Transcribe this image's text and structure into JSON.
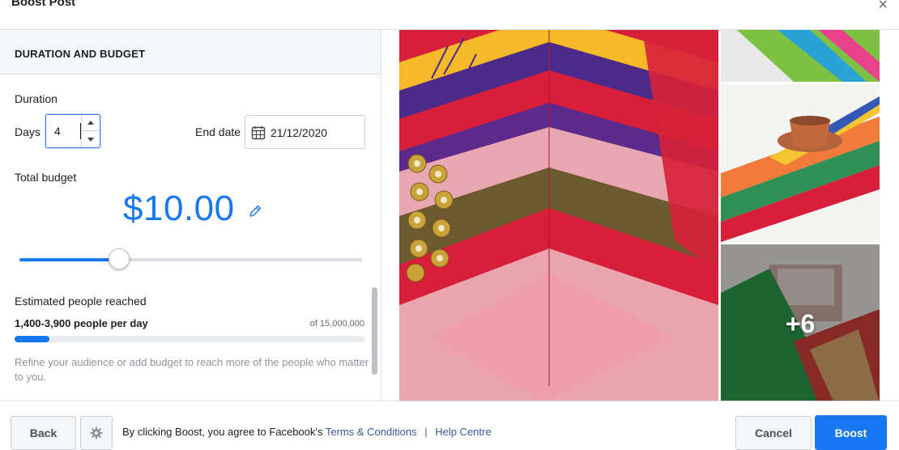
{
  "dialog": {
    "title": "Boost Post",
    "close_glyph": "×"
  },
  "section": {
    "title": "DURATION AND BUDGET"
  },
  "duration": {
    "label": "Duration",
    "days_label": "Days",
    "days_value": "4",
    "end_date_label": "End date",
    "end_date_value": "21/12/2020"
  },
  "budget": {
    "label": "Total budget",
    "amount": "$10.00",
    "slider_fraction": 0.29
  },
  "reach": {
    "title": "Estimated people reached",
    "range": "1,400-3,900 people per day",
    "of_total": "of 15,000,000",
    "bar_fraction": 0.1,
    "note": "Refine your audience or add budget to reach more of the people who matter to you."
  },
  "media": {
    "more_count": "+6"
  },
  "footer": {
    "back_label": "Back",
    "consent_prefix": "By clicking Boost, you agree to Facebook's",
    "terms_link": "Terms & Conditions",
    "separator": "|",
    "help_link": "Help Centre",
    "cancel_label": "Cancel",
    "boost_label": "Boost"
  },
  "colors": {
    "accent": "#1877f2",
    "link": "#385898",
    "section_bg": "#f5f6f7"
  },
  "icons": {
    "close": "close-icon",
    "calendar": "calendar-icon",
    "edit": "pencil-icon",
    "settings": "gear-icon"
  }
}
